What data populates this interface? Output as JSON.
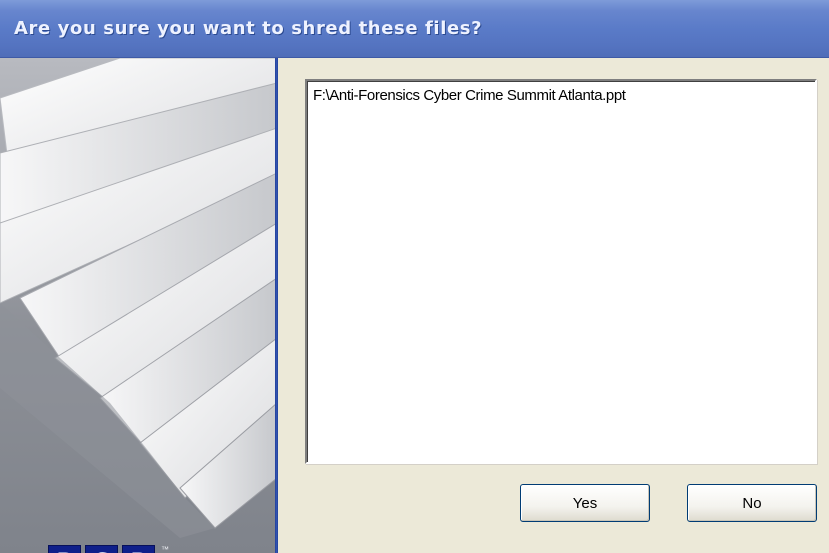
{
  "dialog": {
    "title": "Are you sure you want to shred these files?",
    "files": [
      "F:\\Anti-Forensics Cyber Crime Summit Atlanta.ppt"
    ],
    "buttons": {
      "yes_label": "Yes",
      "no_label": "No"
    }
  },
  "branding": {
    "logo_letters": [
      "P",
      "G",
      "P"
    ],
    "trademark": "™"
  },
  "colors": {
    "title_bar": "#5a7bc8",
    "dialog_background": "#ece9d8",
    "logo_blue": "#0f1f8a",
    "divider_blue": "#1f3f98"
  },
  "icons": {
    "side_art": "paper-strips-shred-graphic"
  }
}
